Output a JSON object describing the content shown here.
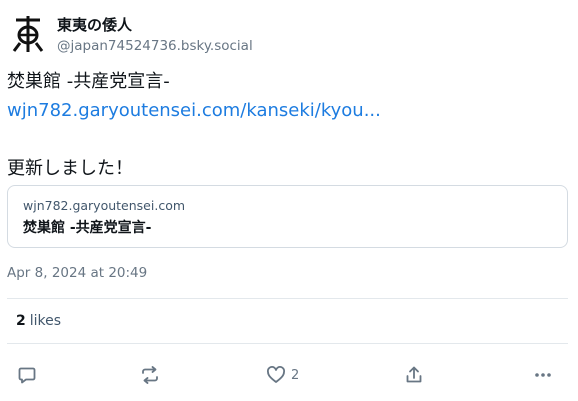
{
  "author": {
    "display_name": "東夷の倭人",
    "handle": "@japan74524736.bsky.social",
    "avatar_icon": "kanji-emblem-avatar"
  },
  "post": {
    "line1": "焚巣館 -共産党宣言-",
    "link_text": "wjn782.garyoutensei.com/kanseki/kyou...",
    "line3": "更新しました！"
  },
  "link_card": {
    "domain": "wjn782.garyoutensei.com",
    "title": "焚巣館 -共産党宣言-"
  },
  "timestamp": "Apr 8, 2024 at 20:49",
  "likes": {
    "count": "2",
    "label": "likes"
  },
  "actions": {
    "reply_icon": "reply-icon",
    "repost_icon": "repost-icon",
    "like_icon": "heart-icon",
    "like_count": "2",
    "share_icon": "share-icon",
    "more_icon": "more-icon"
  },
  "colors": {
    "link": "#1d7ce0",
    "muted": "#687684",
    "border": "#d4dbe2"
  }
}
